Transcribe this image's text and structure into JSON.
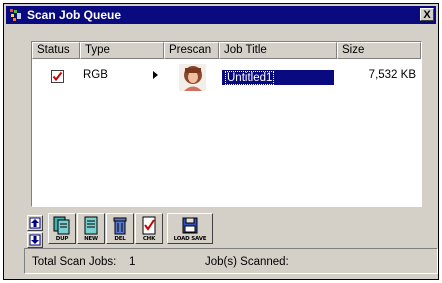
{
  "window": {
    "title": "Scan Job Queue",
    "close_label": "X"
  },
  "columns": [
    "Status",
    "Type",
    "Prescan",
    "Job Title",
    "Size"
  ],
  "jobs": [
    {
      "checked": true,
      "type": "RGB",
      "title": "Untitled1",
      "size": "7,532 KB"
    }
  ],
  "toolbar": {
    "dup": "DUP",
    "new": "NEW",
    "del": "DEL",
    "chk": "CHK",
    "load_save": "LOAD SAVE"
  },
  "status_bar": {
    "total_label": "Total Scan Jobs:",
    "total_value": "1",
    "scanned_label": "Job(s) Scanned:"
  },
  "colors": {
    "title_bar": "#0a0a80",
    "selection": "#0a0a80",
    "check": "#cc0000"
  }
}
